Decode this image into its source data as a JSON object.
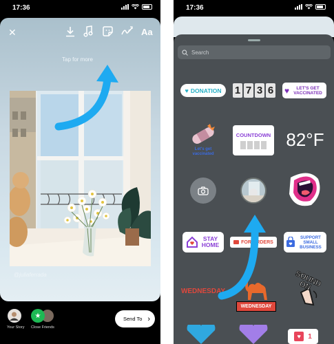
{
  "left": {
    "status_time": "17:36",
    "toolbar": {
      "close_glyph": "✕",
      "text_tool_label": "Aa",
      "tap_for_more": "Tap for more"
    },
    "photo_caption": "@juliaferrada",
    "bottom": {
      "your_story": "Your Story",
      "close_friends": "Close Friends",
      "send_to": "Send To"
    },
    "accent": "#1eaaf1"
  },
  "right": {
    "status_time": "17:36",
    "search_placeholder": "Search",
    "stickers": {
      "donation": "DONATION",
      "clock_time": [
        "1",
        "7",
        "3",
        "6"
      ],
      "lets_get_vaccinated": "LET'S GET VACCINATED",
      "lets_get_vaccinated_small": "Let's get vaccinated",
      "countdown": "COUNTDOWN",
      "temperature": "82°F",
      "stay_home": "STAY HOME",
      "for_orders": "FOR ORDERS",
      "support_small_business": "SUPPORT SMALL BUSINESS",
      "wednesday_text": "WEDNESDAY",
      "wednesday_badge": "WEDNESDAY",
      "sound_on": "SOUND ON",
      "like_count": "1"
    },
    "colors": {
      "sheet": "#4a4f53",
      "donation_teal": "#26b0c6",
      "vaccinated_purple": "#7c2fb8",
      "stay_home_purple": "#8a3fd6",
      "wednesday_red": "#e0483c",
      "like_red": "#e8455b"
    }
  }
}
